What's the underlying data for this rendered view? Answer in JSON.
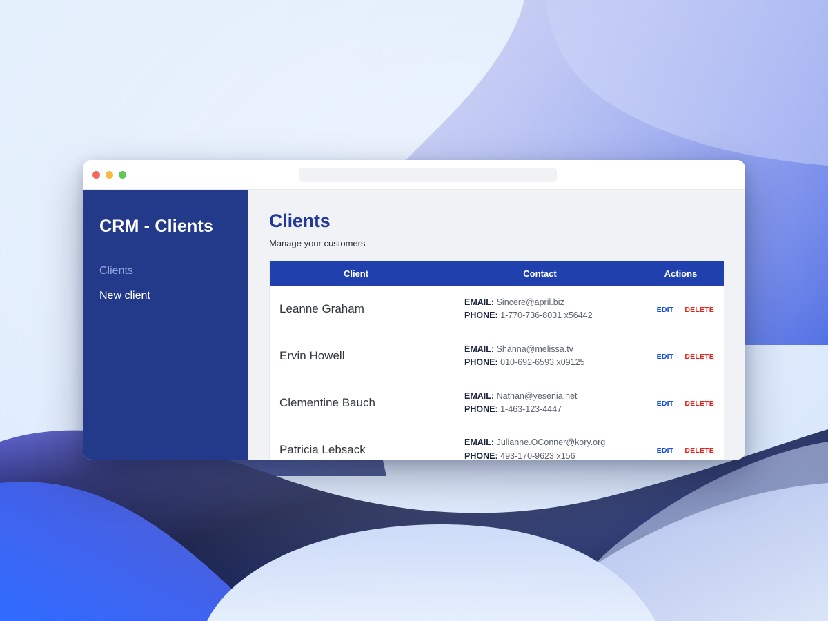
{
  "window": {
    "traffic_lights": [
      "close-red",
      "minimize-amber",
      "maximize-green"
    ],
    "url_value": "",
    "url_placeholder": ""
  },
  "sidebar": {
    "brand": "CRM - Clients",
    "items": [
      {
        "label": "Clients",
        "state": "muted"
      },
      {
        "label": "New client",
        "state": "plain"
      }
    ]
  },
  "main": {
    "title": "Clients",
    "subtitle": "Manage your customers",
    "table": {
      "columns": [
        "Client",
        "Contact",
        "Actions"
      ],
      "labels": {
        "email": "EMAIL:",
        "phone": "PHONE:"
      },
      "actions": {
        "edit": "EDIT",
        "delete": "DELETE"
      },
      "rows": [
        {
          "name": "Leanne Graham",
          "email": "Sincere@april.biz",
          "phone": "1-770-736-8031 x56442"
        },
        {
          "name": "Ervin Howell",
          "email": "Shanna@melissa.tv",
          "phone": "010-692-6593 x09125"
        },
        {
          "name": "Clementine Bauch",
          "email": "Nathan@yesenia.net",
          "phone": "1-463-123-4447"
        },
        {
          "name": "Patricia Lebsack",
          "email": "Julianne.OConner@kory.org",
          "phone": "493-170-9623 x156"
        }
      ]
    }
  },
  "colors": {
    "sidebar_bg": "#23398a",
    "table_header_bg": "#2040ad",
    "title_blue": "#22399b",
    "edit_blue": "#1a4fe0",
    "delete_red": "#e8231c",
    "app_bg": "#f1f2f6"
  }
}
